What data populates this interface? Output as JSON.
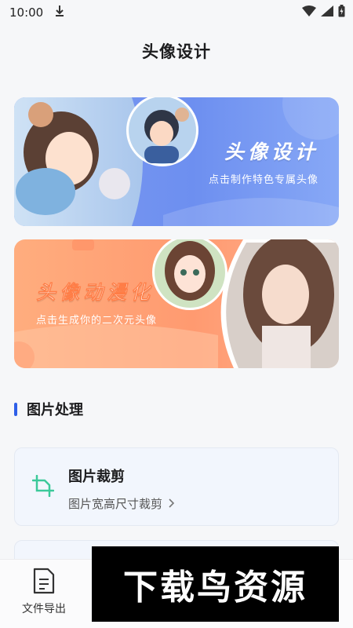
{
  "status_bar": {
    "time": "10:00"
  },
  "header": {
    "title": "头像设计"
  },
  "banners": [
    {
      "title": "头像设计",
      "subtitle": "点击制作特色专属头像"
    },
    {
      "title": "头像动漫化",
      "subtitle": "点击生成你的二次元头像"
    }
  ],
  "section": {
    "title": "图片处理"
  },
  "cards": [
    {
      "title": "图片裁剪",
      "subtitle": "图片宽高尺寸裁剪"
    }
  ],
  "bottom_nav": {
    "items": [
      {
        "label": "文件导出"
      }
    ]
  },
  "watermark": {
    "text": "下载鸟资源"
  },
  "colors": {
    "accent": "#2e5fe8",
    "banner_blue": "#6d8ff0",
    "banner_orange": "#ff9a70",
    "crop_icon": "#3cc99a"
  }
}
